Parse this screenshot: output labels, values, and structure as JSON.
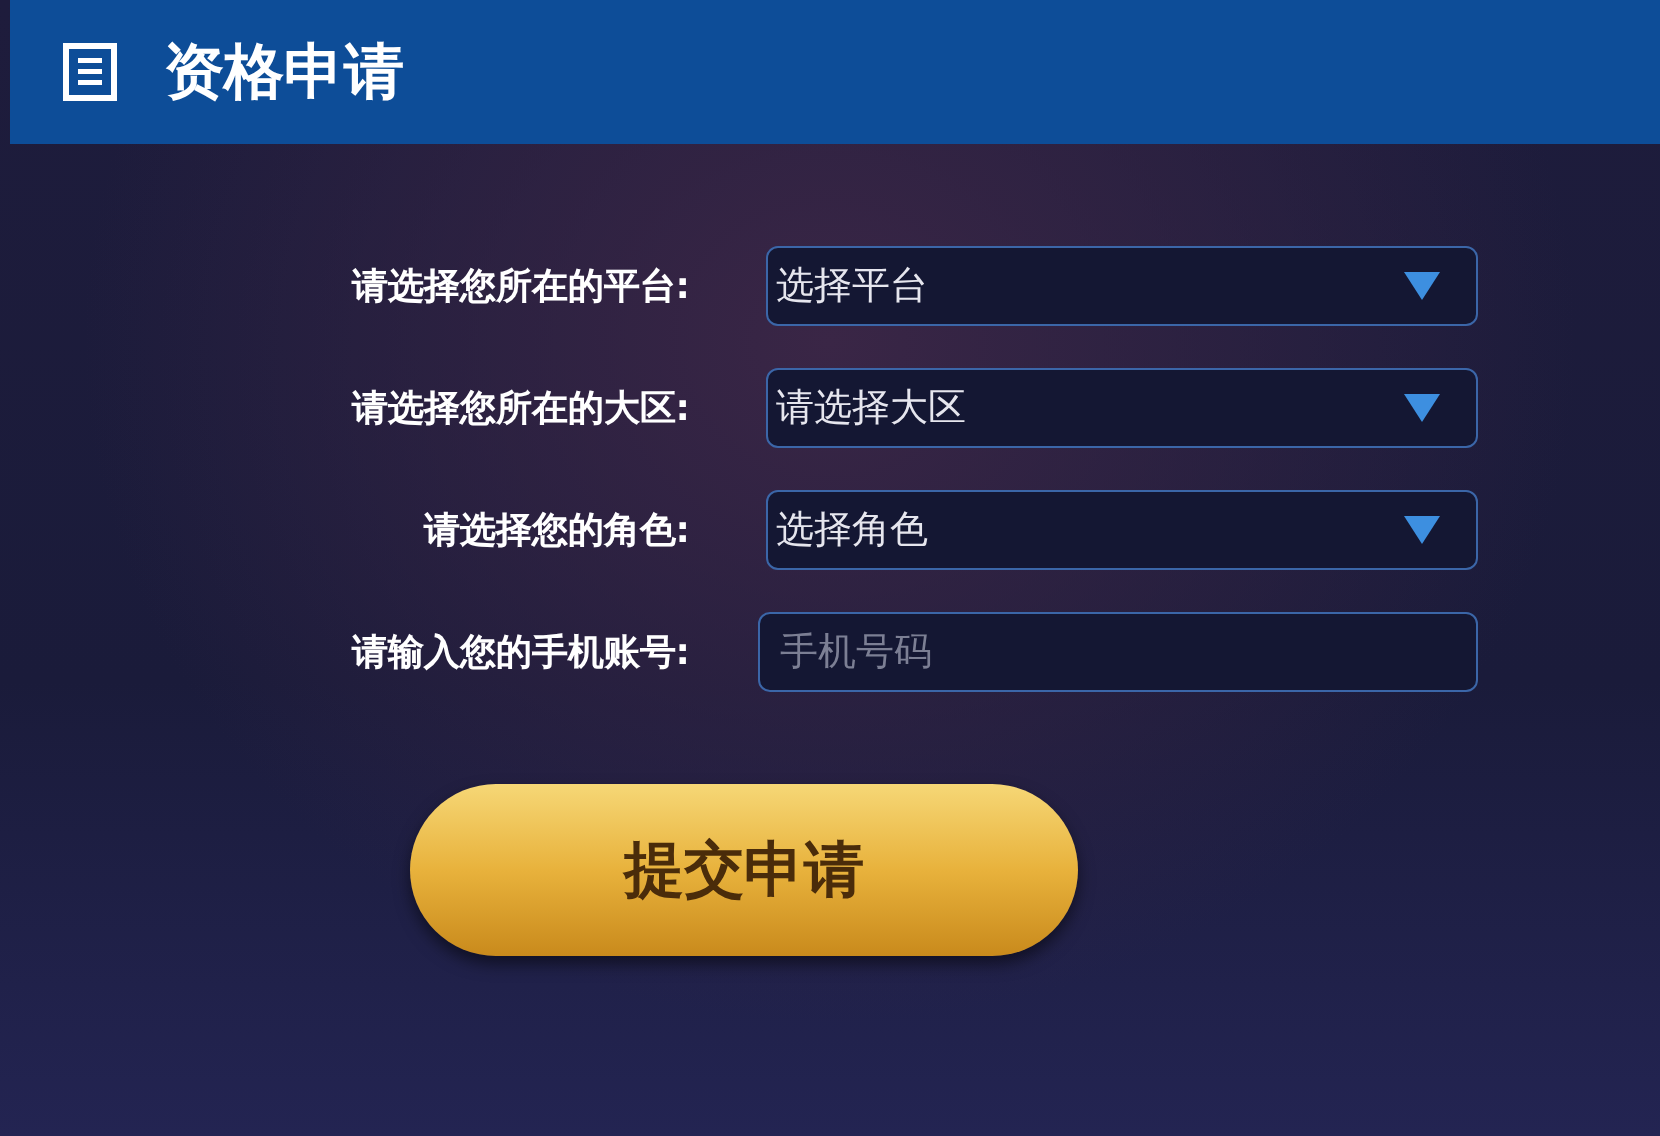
{
  "header": {
    "title": "资格申请"
  },
  "fields": [
    {
      "kind": "select",
      "label": "请选择您所在的平台:",
      "value": "选择平台"
    },
    {
      "kind": "select",
      "label": "请选择您所在的大区:",
      "value": "请选择大区"
    },
    {
      "kind": "select",
      "label": "请选择您的角色:",
      "value": "选择角色"
    },
    {
      "kind": "input",
      "label": "请输入您的手机账号:",
      "placeholder": "手机号码"
    }
  ],
  "submit_button": "提交申请"
}
